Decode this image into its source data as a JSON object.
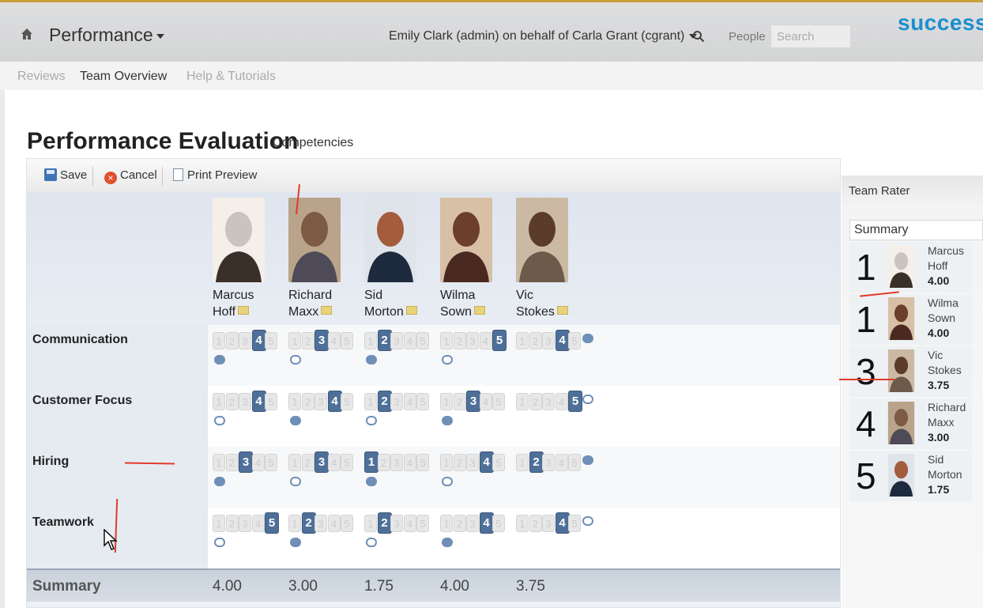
{
  "topbar": {
    "module": "Performance",
    "user": "Emily Clark (admin) on behalf of Carla Grant (cgrant)",
    "people_label": "People",
    "search_placeholder": "Search",
    "brand": "success"
  },
  "subnav": [
    "Reviews",
    "Team Overview",
    "Help & Tutorials"
  ],
  "page": {
    "title": "Performance Evaluation",
    "subtitle": "Competencies"
  },
  "toolbar": {
    "save": "Save",
    "cancel": "Cancel",
    "print": "Print Preview"
  },
  "employees": [
    {
      "first": "Marcus",
      "last": "Hoff"
    },
    {
      "first": "Richard",
      "last": "Maxx"
    },
    {
      "first": "Sid",
      "last": "Morton"
    },
    {
      "first": "Wilma",
      "last": "Sown"
    },
    {
      "first": "Vic",
      "last": "Stokes"
    }
  ],
  "competencies": [
    {
      "name": "Communication",
      "ratings": [
        4,
        3,
        2,
        5,
        4
      ]
    },
    {
      "name": "Customer Focus",
      "ratings": [
        4,
        4,
        2,
        3,
        5
      ]
    },
    {
      "name": "Hiring",
      "ratings": [
        3,
        3,
        1,
        4,
        2
      ]
    },
    {
      "name": "Teamwork",
      "ratings": [
        5,
        2,
        2,
        4,
        4
      ]
    }
  ],
  "summary": {
    "label": "Summary",
    "values": [
      "4.00",
      "3.00",
      "1.75",
      "4.00",
      "3.75"
    ]
  },
  "team_rater": {
    "title": "Team Rater",
    "summary_label": "Summary",
    "ranks": [
      {
        "rank": "1",
        "first": "Marcus",
        "last": "Hoff",
        "score": "4.00"
      },
      {
        "rank": "1",
        "first": "Wilma",
        "last": "Sown",
        "score": "4.00"
      },
      {
        "rank": "3",
        "first": "Vic",
        "last": "Stokes",
        "score": "3.75"
      },
      {
        "rank": "4",
        "first": "Richard",
        "last": "Maxx",
        "score": "3.00"
      },
      {
        "rank": "5",
        "first": "Sid",
        "last": "Morton",
        "score": "1.75"
      }
    ]
  },
  "colors": {
    "brand": "#1a8fd0",
    "selected_rating": "#4e6f98",
    "annotation": "#e23a2a"
  }
}
